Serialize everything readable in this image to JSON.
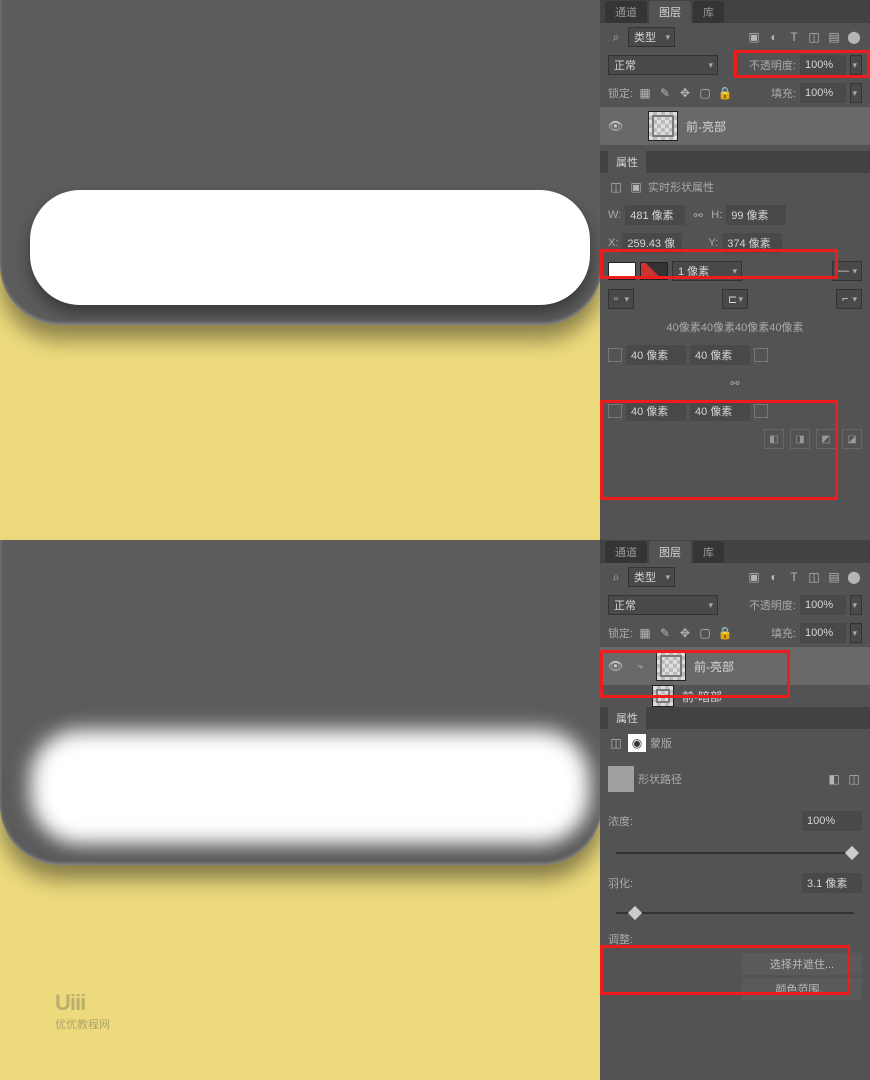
{
  "top": {
    "tabs": {
      "channels": "通道",
      "layers": "图层",
      "paths": "库"
    },
    "filter_label": "类型",
    "blend_mode": "正常",
    "opacity_label": "不透明度:",
    "opacity_value": "100%",
    "lock_label": "锁定:",
    "fill_label": "填充:",
    "fill_value": "100%",
    "layer_name": "前-亮部",
    "props": {
      "title": "属性",
      "subtitle": "实时形状属性",
      "w_label": "W:",
      "w_value": "481 像素",
      "h_label": "H:",
      "h_value": "99 像素",
      "x_label": "X:",
      "x_value": "259.43 像",
      "y_label": "Y:",
      "y_value": "374 像素",
      "stroke_width": "1 像素",
      "radius_summary": "40像素40像素40像素40像素",
      "r_tl": "40 像素",
      "r_tr": "40 像素",
      "r_bl": "40 像素",
      "r_br": "40 像素"
    }
  },
  "bottom": {
    "tabs": {
      "channels": "通道",
      "layers": "图层",
      "paths": "库"
    },
    "filter_label": "类型",
    "blend_mode": "正常",
    "opacity_label": "不透明度:",
    "opacity_value": "100%",
    "lock_label": "锁定:",
    "fill_label": "填充:",
    "fill_value": "100%",
    "layer_name": "前-亮部",
    "layer2_name": "前-暗部",
    "props": {
      "title": "属性",
      "mask_label": "蒙版",
      "path_label": "形状路径",
      "density_label": "浓度:",
      "density_value": "100%",
      "feather_label": "羽化:",
      "feather_value": "3.1 像素",
      "adjust_label": "调整:",
      "select_hold": "选择并遮住...",
      "color_range": "颜色范围..."
    },
    "watermark_main": "Uiii",
    "watermark_sub": "优优教程网"
  }
}
